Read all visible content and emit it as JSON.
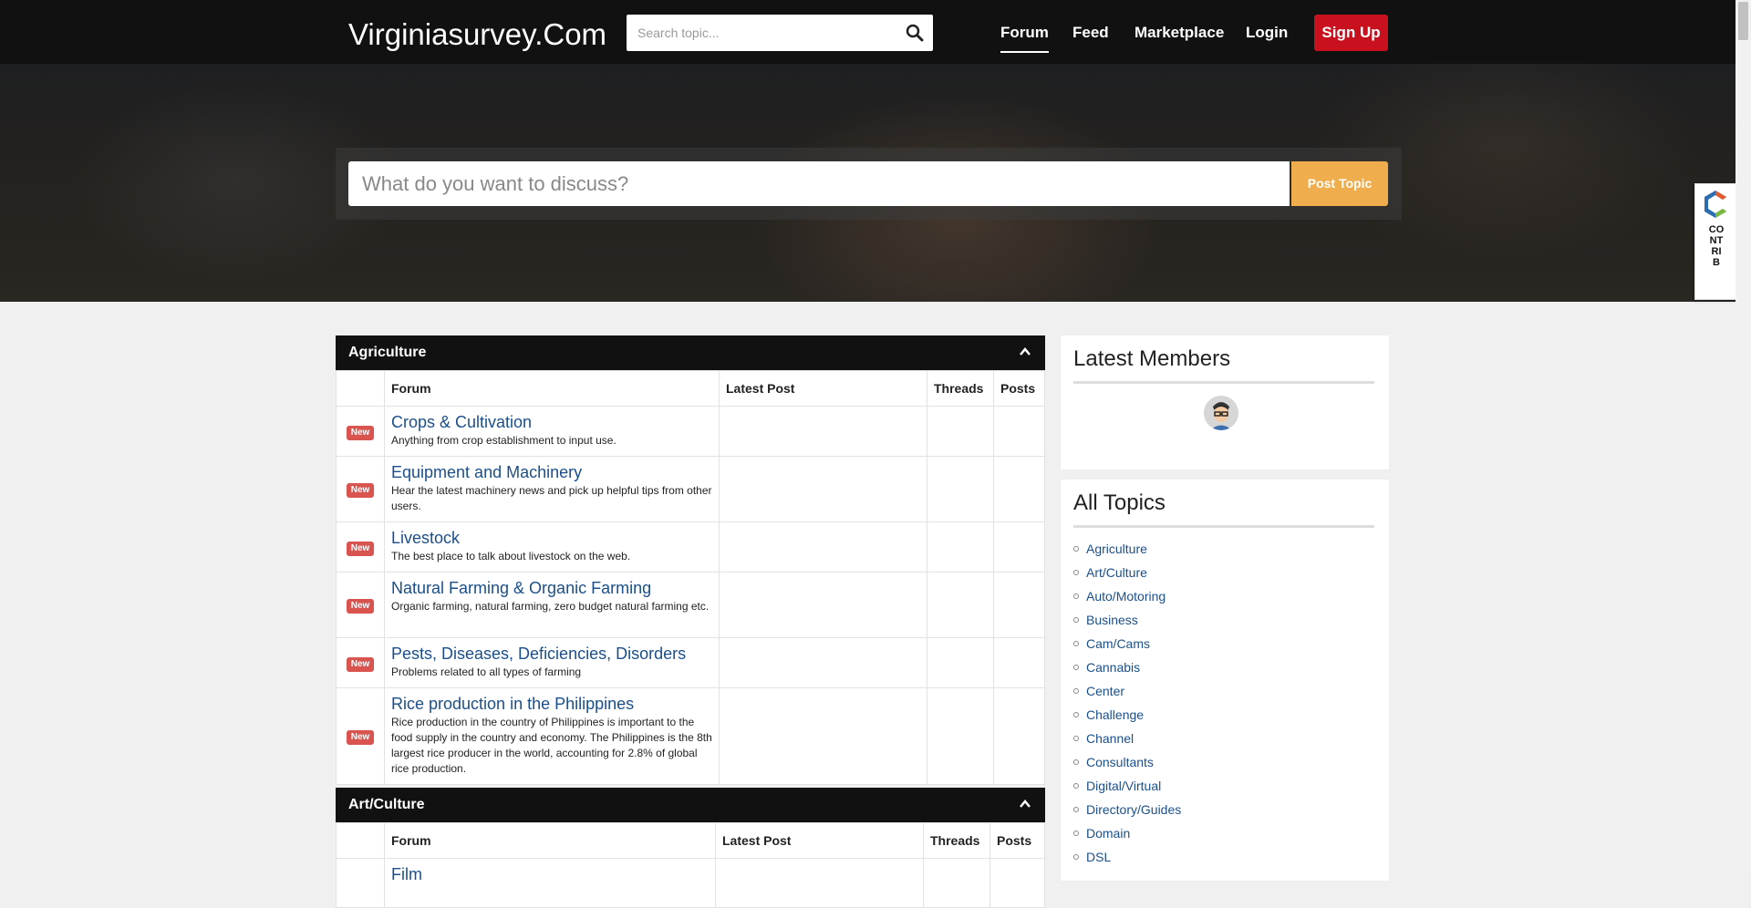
{
  "site": {
    "brand": "Virginiasurvey.Com"
  },
  "header": {
    "search_placeholder": "Search topic...",
    "nav": [
      {
        "label": "Forum",
        "active": true
      },
      {
        "label": "Feed"
      },
      {
        "label": "Marketplace"
      },
      {
        "label": "Login"
      }
    ],
    "signup_label": "Sign Up"
  },
  "hero": {
    "input_placeholder": "What do you want to discuss?",
    "post_button": "Post Topic"
  },
  "contrib_badge": {
    "text": "CONTRIB"
  },
  "columns": {
    "forum": "Forum",
    "latest_post": "Latest Post",
    "threads": "Threads",
    "posts": "Posts"
  },
  "categories": [
    {
      "title": "Agriculture",
      "forums": [
        {
          "badge": "New",
          "name": "Crops & Cultivation",
          "desc": "Anything from crop establishment to input use.",
          "latest_post": "",
          "threads": "",
          "posts": ""
        },
        {
          "badge": "New",
          "name": "Equipment and Machinery",
          "desc": "Hear the latest machinery news and pick up helpful tips from other users.",
          "latest_post": "",
          "threads": "",
          "posts": ""
        },
        {
          "badge": "New",
          "name": "Livestock",
          "desc": "The best place to talk about livestock on the web.",
          "latest_post": "",
          "threads": "",
          "posts": ""
        },
        {
          "badge": "New",
          "name": "Natural Farming & Organic Farming",
          "desc": "Organic farming, natural farming, zero budget natural farming etc.",
          "latest_post": "",
          "threads": "",
          "posts": ""
        },
        {
          "badge": "New",
          "name": "Pests, Diseases, Deficiencies, Disorders",
          "desc": "Problems related to all types of farming",
          "latest_post": "",
          "threads": "",
          "posts": ""
        },
        {
          "badge": "New",
          "name": "Rice production in the Philippines",
          "desc": "Rice production in the country of Philippines is important to the food supply in the country and economy. The Philippines is the 8th largest rice producer in the world, accounting for 2.8% of global rice production.",
          "latest_post": "",
          "threads": "",
          "posts": ""
        }
      ]
    },
    {
      "title": "Art/Culture",
      "forums": [
        {
          "badge": "",
          "name": "Film",
          "desc": "",
          "latest_post": "",
          "threads": "",
          "posts": ""
        }
      ]
    }
  ],
  "sidebar": {
    "latest_members_title": "Latest Members",
    "all_topics_title": "All Topics",
    "topics": [
      "Agriculture",
      "Art/Culture",
      "Auto/Motoring",
      "Business",
      "Cam/Cams",
      "Cannabis",
      "Center",
      "Challenge",
      "Channel",
      "Consultants",
      "Digital/Virtual",
      "Directory/Guides",
      "Domain",
      "DSL"
    ]
  }
}
